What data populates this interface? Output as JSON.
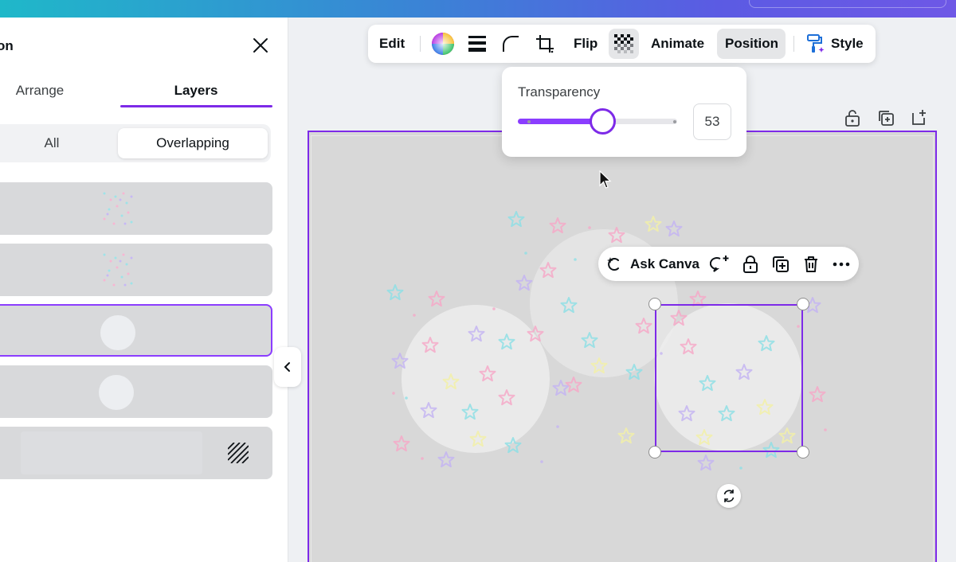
{
  "panel": {
    "title": "on",
    "tabs": {
      "arrange": "Arrange",
      "layers": "Layers"
    },
    "filter": {
      "all": "All",
      "overlapping": "Overlapping"
    },
    "layers": [
      {
        "kind": "stars"
      },
      {
        "kind": "stars"
      },
      {
        "kind": "circle",
        "selected": true
      },
      {
        "kind": "circle"
      },
      {
        "kind": "background"
      }
    ]
  },
  "toolbar": {
    "edit": "Edit",
    "flip": "Flip",
    "animate": "Animate",
    "position": "Position",
    "style": "Style",
    "icons": [
      "color-wheel-icon",
      "line-weight-icon",
      "corner-rounding-icon",
      "crop-icon",
      "transparency-icon",
      "paint-roller-icon"
    ]
  },
  "transparency": {
    "label": "Transparency",
    "value": "53",
    "fraction": 0.53
  },
  "context_menu": {
    "ask_canva": "Ask Canva",
    "icons": [
      "magic-sparkle-icon",
      "comment-icon",
      "lock-icon",
      "duplicate-icon",
      "trash-icon",
      "more-icon"
    ]
  },
  "page_actions": [
    "unlock-icon",
    "duplicate-page-icon",
    "add-page-icon"
  ],
  "colors": {
    "accent": "#7d2ae8",
    "canvas_bg": "#d8d8d8",
    "panel_bg": "#ffffff"
  }
}
